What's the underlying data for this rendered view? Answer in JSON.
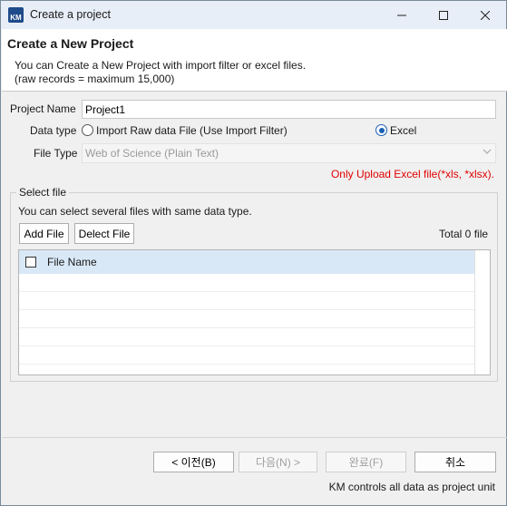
{
  "window": {
    "icon_text": "KM",
    "title": "Create a project"
  },
  "header": {
    "title": "Create a New Project",
    "desc_line1": "You can Create a New Project with import filter or excel files.",
    "desc_line2": "(raw records = maximum 15,000)"
  },
  "form": {
    "project_name_label": "Project Name",
    "project_name_value": "Project1",
    "data_type_label": "Data type",
    "data_type_options": [
      {
        "label": "Import Raw data File (Use Import Filter)",
        "selected": false
      },
      {
        "label": "Excel",
        "selected": true
      }
    ],
    "file_type_label": "File Type",
    "file_type_value": "Web of Science (Plain Text)",
    "warning": "Only Upload Excel file(*xls, *xlsx)."
  },
  "select_file": {
    "title": "Select file",
    "hint": "You can select several files with same data type.",
    "add_button": "Add File",
    "delete_button": "Delect File",
    "total": "Total 0 file",
    "column_header": "File Name"
  },
  "footer": {
    "back_button": "< 이전(B)",
    "next_button": "다음(N) >",
    "finish_button": "완료(F)",
    "cancel_button": "취소",
    "status": "KM controls all data as project unit"
  },
  "colors": {
    "title_bar": "#e8eef7",
    "accent": "#1a5fb4",
    "warning": "#e00000",
    "table_header": "#d9e8f7"
  }
}
